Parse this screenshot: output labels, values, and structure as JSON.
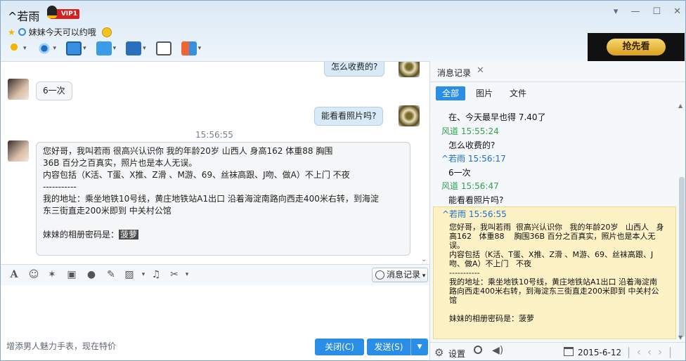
{
  "window": {
    "name": "^若雨",
    "vip": "VIP1",
    "status_message": "妹妹今天可以约哦",
    "ad_button": "抢先看"
  },
  "chat": {
    "partial_prev": "怎么收费的?",
    "msg1": "6一次",
    "msg2": "能看看照片吗?",
    "timestamp": "15:56:55",
    "long_lines": [
      "您好哥，我叫若雨  很高兴认识你   我的年龄20岁   山西人   身高162   体重88    胸围",
      "36B 百分之百真实，照片也是本人无误。",
      "内容包括（K活、T蛋、X推、Z滑 、M游、69、丝袜高跟、J吻、做A）不上门   不夜",
      "-----------",
      "我的地址：乘坐地铁10号线，黄庄地铁站A1出口 沿着海淀南路向西走400米右转，到海淀",
      "东三街直走200米即到 中关村公馆"
    ],
    "album_label": "妹妹的相册密码是：",
    "album_password": "菠萝"
  },
  "input": {
    "history_button": "消息记录",
    "ad_text": "增添男人魅力手表，现在特价",
    "close_button": "关闭(C)",
    "send_button": "发送(S)"
  },
  "history": {
    "tab_title": "消息记录",
    "filters": [
      "全部",
      "图片",
      "文件"
    ],
    "rows": [
      "在、今天最早也得 7.40了",
      "风道 15:55:24",
      "怎么收费的?",
      "^若雨 15:56:17",
      "6一次",
      "风道 15:56:47",
      "能看看照片吗?",
      "^若雨 15:56:55"
    ],
    "highlight_body": "您好哥，我叫若雨  很高兴认识你   我的年龄20岁   山西人   身高162   体重88    胸围36B 百分之百真实，照片也是本人无误。\n内容包括（K活、T蛋、X推、Z滑 、M游、69、丝袜高跟、J吻、做A）不上门   不夜\n-----------\n我的地址：乘坐地铁10号线，黄庄地铁站A1出口 沿着海淀南路向西走400米右转，到海淀东三街直走200米即到 中关村公馆\n\n妹妹的相册密码是：菠萝",
    "settings_label": "设置",
    "date": "2015-6-12"
  },
  "colors": {
    "accent": "#2a8ee6",
    "green_sender": "#2fa24a",
    "blue_sender": "#1a6fd0",
    "highlight": "#fdf2c6"
  }
}
